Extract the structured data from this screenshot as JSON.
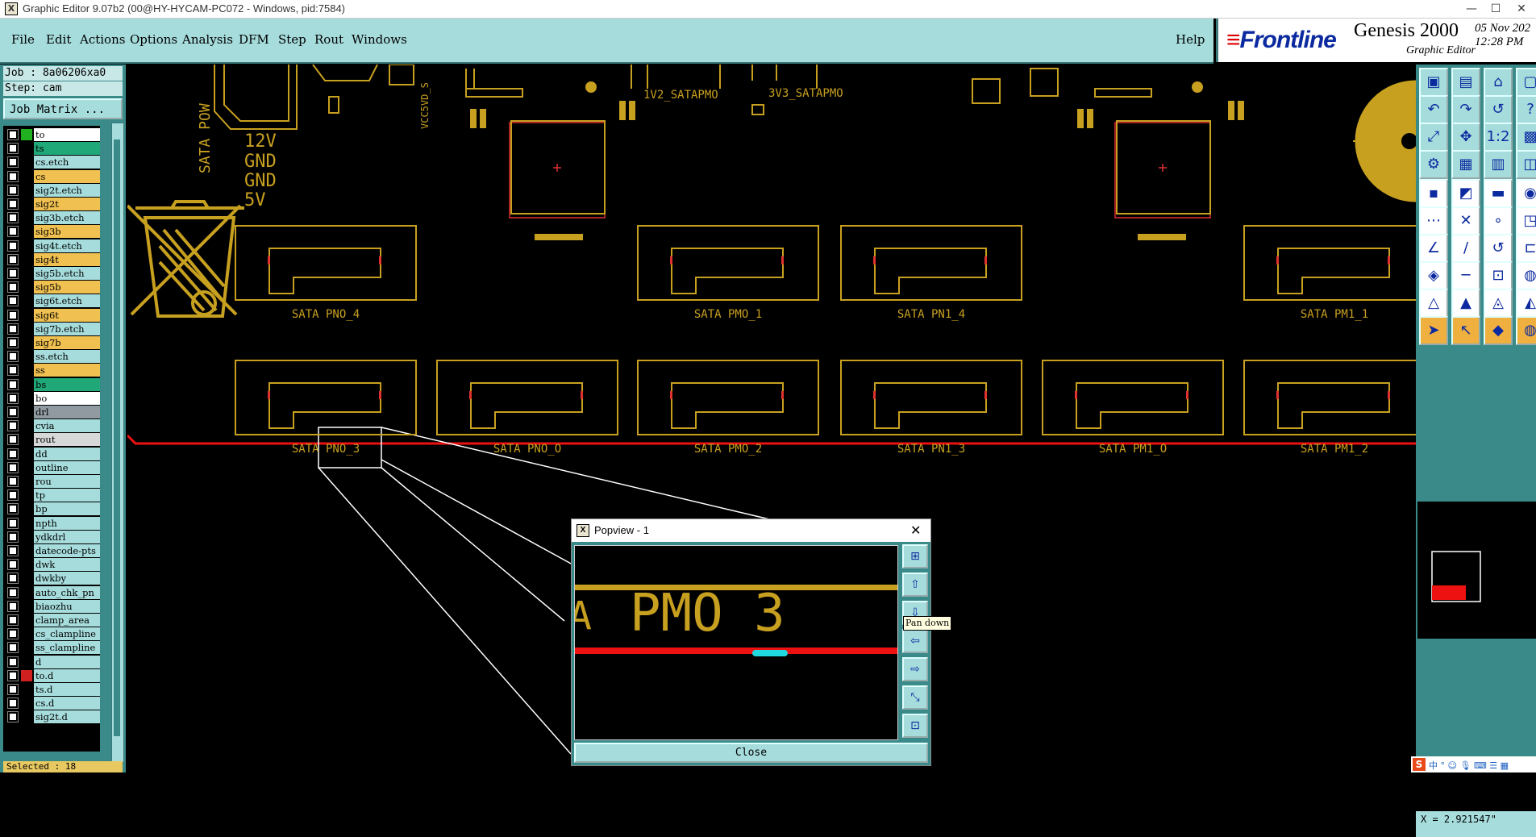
{
  "window": {
    "title": "Graphic Editor 9.07b2 (00@HY-HYCAM-PC072 - Windows, pid:7584)",
    "min_glyph": "—",
    "max_glyph": "☐",
    "close_glyph": "✕"
  },
  "menu": {
    "items": [
      {
        "label": "File",
        "accel": "F"
      },
      {
        "label": "Edit",
        "accel": "E"
      },
      {
        "label": "Actions",
        "accel": "A"
      },
      {
        "label": "Options",
        "accel": "O"
      },
      {
        "label": "Analysis",
        "accel": "n"
      },
      {
        "label": "DFM",
        "accel": "D"
      },
      {
        "label": "Step",
        "accel": "S"
      },
      {
        "label": "Rout",
        "accel": "R"
      },
      {
        "label": "Windows",
        "accel": "W"
      }
    ],
    "help": "Help"
  },
  "brand": {
    "logo": "Frontline",
    "product": "Genesis 2000",
    "subtitle": "Graphic Editor",
    "date": "05 Nov 202",
    "time": "12:28 PM"
  },
  "left": {
    "job": "Job : 8a06206xa0",
    "step": "Step: cam",
    "job_matrix": "Job Matrix ...",
    "selected": "Selected : 18",
    "layers": [
      {
        "name": "to",
        "color": "#ffffff",
        "mark": "green"
      },
      {
        "name": "ts",
        "color": "#20a878"
      },
      {
        "name": "cs.etch",
        "color": "#a6dcdc"
      },
      {
        "name": "cs",
        "color": "#f0c050"
      },
      {
        "name": "sig2t.etch",
        "color": "#a6dcdc"
      },
      {
        "name": "sig2t",
        "color": "#f0c050"
      },
      {
        "name": "sig3b.etch",
        "color": "#a6dcdc"
      },
      {
        "name": "sig3b",
        "color": "#f0c050"
      },
      {
        "name": "sig4t.etch",
        "color": "#a6dcdc"
      },
      {
        "name": "sig4t",
        "color": "#f0c050"
      },
      {
        "name": "sig5b.etch",
        "color": "#a6dcdc"
      },
      {
        "name": "sig5b",
        "color": "#f0c050"
      },
      {
        "name": "sig6t.etch",
        "color": "#a6dcdc"
      },
      {
        "name": "sig6t",
        "color": "#f0c050"
      },
      {
        "name": "sig7b.etch",
        "color": "#a6dcdc"
      },
      {
        "name": "sig7b",
        "color": "#f0c050"
      },
      {
        "name": "ss.etch",
        "color": "#a6dcdc"
      },
      {
        "name": "ss",
        "color": "#f0c050"
      },
      {
        "name": "bs",
        "color": "#20a878"
      },
      {
        "name": "bo",
        "color": "#ffffff"
      },
      {
        "name": "drl",
        "color": "#909aa0"
      },
      {
        "name": "cvia",
        "color": "#a6dcdc"
      },
      {
        "name": "rout",
        "color": "#d8d8d8"
      },
      {
        "name": "dd",
        "color": "#a6dcdc"
      },
      {
        "name": "outline",
        "color": "#a6dcdc"
      },
      {
        "name": "rou",
        "color": "#a6dcdc"
      },
      {
        "name": "tp",
        "color": "#a6dcdc"
      },
      {
        "name": "bp",
        "color": "#a6dcdc"
      },
      {
        "name": "npth",
        "color": "#a6dcdc"
      },
      {
        "name": "ydkdrl",
        "color": "#a6dcdc"
      },
      {
        "name": "datecode-pts",
        "color": "#a6dcdc"
      },
      {
        "name": "dwk",
        "color": "#a6dcdc"
      },
      {
        "name": "dwkby",
        "color": "#a6dcdc"
      },
      {
        "name": "auto_chk_pn",
        "color": "#a6dcdc"
      },
      {
        "name": "biaozhu",
        "color": "#a6dcdc"
      },
      {
        "name": "clamp_area",
        "color": "#a6dcdc"
      },
      {
        "name": "cs_clampline",
        "color": "#a6dcdc"
      },
      {
        "name": "ss_clampline",
        "color": "#a6dcdc"
      },
      {
        "name": "d",
        "color": "#a6dcdc"
      },
      {
        "name": "to.d",
        "color": "#a6dcdc",
        "mark": "red"
      },
      {
        "name": "ts.d",
        "color": "#a6dcdc"
      },
      {
        "name": "cs.d",
        "color": "#a6dcdc"
      },
      {
        "name": "sig2t.d",
        "color": "#a6dcdc"
      }
    ]
  },
  "canvas": {
    "labels": {
      "sata_pow": "SATA POW",
      "v12": "12V",
      "gnd1": "GND",
      "gnd2": "GND",
      "v5": "5V",
      "vcc5vd": "VCC5VD_S",
      "v2_satapmo": "1V2_SATAPMO",
      "v3_satapmo": "3V3_SATAPMO"
    },
    "row1": [
      "SATA PNO_4",
      "SATA PMO_1",
      "SATA PN1_4",
      "SATA PM1_1"
    ],
    "row2": [
      "SATA PNO_3",
      "SATA PNO_O",
      "SATA PMO_2",
      "SATA PN1_3",
      "SATA PM1_O",
      "SATA PM1_2"
    ]
  },
  "popview": {
    "title": "Popview - 1",
    "zoom_text": "PMO 3",
    "edge_glyph": "A",
    "close_label": "Close",
    "tooltip": "Pan down"
  },
  "right": {
    "coord": "X = 2.921547\"",
    "ime_glyph": "S",
    "ime_icons": "中 ° ☺ 🎙 ⌨ ☰ ▦"
  },
  "colors": {
    "panel_cyan": "#a6dcdc",
    "panel_teal": "#3a8a8a",
    "layer_gold": "#c8a020",
    "red_line": "#ee1111",
    "accent_cyan": "#20d8e0"
  }
}
